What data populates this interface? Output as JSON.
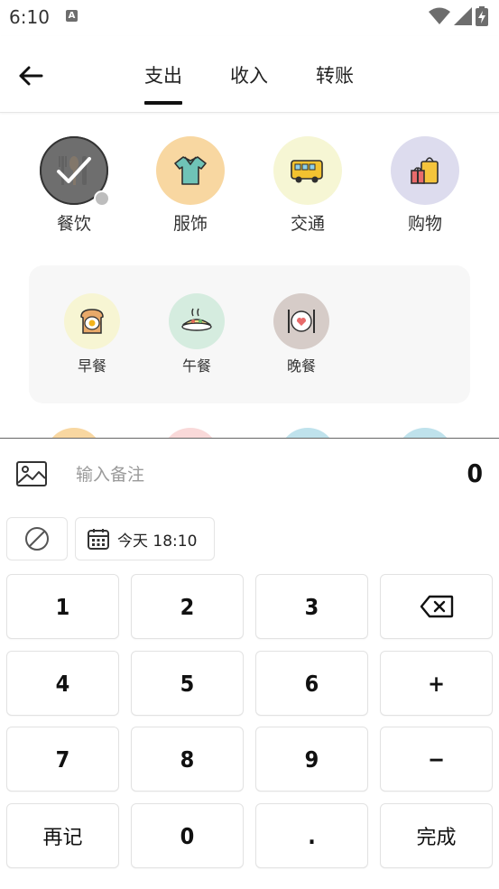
{
  "status_bar": {
    "time": "6:10",
    "notif_icon_letter": "A"
  },
  "header": {
    "tabs": [
      {
        "label": "支出",
        "active": true
      },
      {
        "label": "收入",
        "active": false
      },
      {
        "label": "转账",
        "active": false
      }
    ]
  },
  "categories": [
    {
      "label": "餐饮",
      "bg": "#6e6e6e",
      "icon": "utensils-icon",
      "selected": true
    },
    {
      "label": "服饰",
      "bg": "#f8d7a1",
      "icon": "shirt-icon",
      "selected": false
    },
    {
      "label": "交通",
      "bg": "#f6f6d4",
      "icon": "bus-icon",
      "selected": false
    },
    {
      "label": "购物",
      "bg": "#dddcee",
      "icon": "shopping-bag-icon",
      "selected": false
    }
  ],
  "subcategories": [
    {
      "label": "早餐",
      "bg": "#f7f5d3",
      "icon": "toast-egg-icon"
    },
    {
      "label": "午餐",
      "bg": "#d5ecdf",
      "icon": "rice-dish-icon"
    },
    {
      "label": "晚餐",
      "bg": "#d6ccc8",
      "icon": "dinner-plate-icon"
    }
  ],
  "entry": {
    "note_placeholder": "输入备注",
    "amount": "0",
    "date_label": "今天 18:10"
  },
  "keypad": {
    "rows": [
      [
        "1",
        "2",
        "3",
        "⌫"
      ],
      [
        "4",
        "5",
        "6",
        "+"
      ],
      [
        "7",
        "8",
        "9",
        "−"
      ],
      [
        "再记",
        "0",
        ".",
        "完成"
      ]
    ]
  },
  "colors": {
    "accent": "#111111",
    "panel_bg": "#f7f7f7",
    "peek_colors": [
      "#f8d7a1",
      "#f9d9d9",
      "#bfe2ec",
      "#bfe2ec"
    ]
  }
}
